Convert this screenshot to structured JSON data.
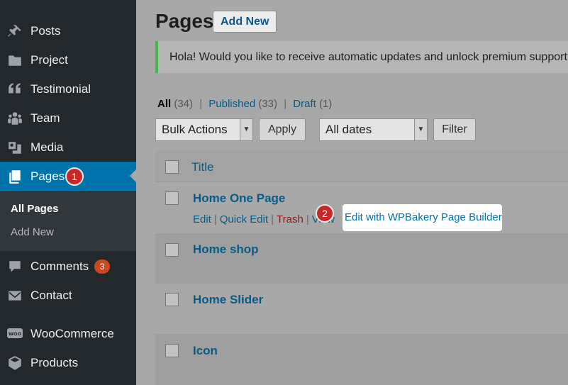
{
  "sidebar": {
    "items": [
      {
        "label": "Posts",
        "icon": "pin-icon"
      },
      {
        "label": "Project",
        "icon": "folder-icon"
      },
      {
        "label": "Testimonial",
        "icon": "quote-icon"
      },
      {
        "label": "Team",
        "icon": "group-icon"
      },
      {
        "label": "Media",
        "icon": "media-icon"
      },
      {
        "label": "Pages",
        "icon": "pages-icon"
      },
      {
        "label": "Comments",
        "icon": "comment-icon",
        "badge": "3"
      },
      {
        "label": "Contact",
        "icon": "mail-icon"
      },
      {
        "label": "WooCommerce",
        "icon": "woo-icon"
      },
      {
        "label": "Products",
        "icon": "box-icon"
      }
    ],
    "submenu": {
      "all_pages": "All Pages",
      "add_new": "Add New"
    },
    "active": "Pages",
    "colors": {
      "background": "#23282d",
      "active": "#0073aa",
      "submenu": "#32373c"
    }
  },
  "steps": {
    "one": "1",
    "two": "2"
  },
  "main": {
    "title": "Pages",
    "add_new": "Add New",
    "notice": "Hola! Would you like to receive automatic updates and unlock premium support?",
    "views": {
      "all": "All",
      "all_count": "(34)",
      "published": "Published",
      "published_count": "(33)",
      "draft": "Draft",
      "draft_count": "(1)",
      "separator": "|"
    },
    "bulk_actions": "Bulk Actions",
    "apply": "Apply",
    "dates": "All dates",
    "filter": "Filter",
    "column_title": "Title",
    "rows": [
      {
        "title": "Home One Page"
      },
      {
        "title": "Home shop"
      },
      {
        "title": "Home Slider"
      },
      {
        "title": "Icon"
      }
    ],
    "row_actions": {
      "edit": "Edit",
      "quick_edit": "Quick Edit",
      "trash": "Trash",
      "view": "View",
      "wpbakery": "Edit with WPBakery Page Builder"
    }
  }
}
